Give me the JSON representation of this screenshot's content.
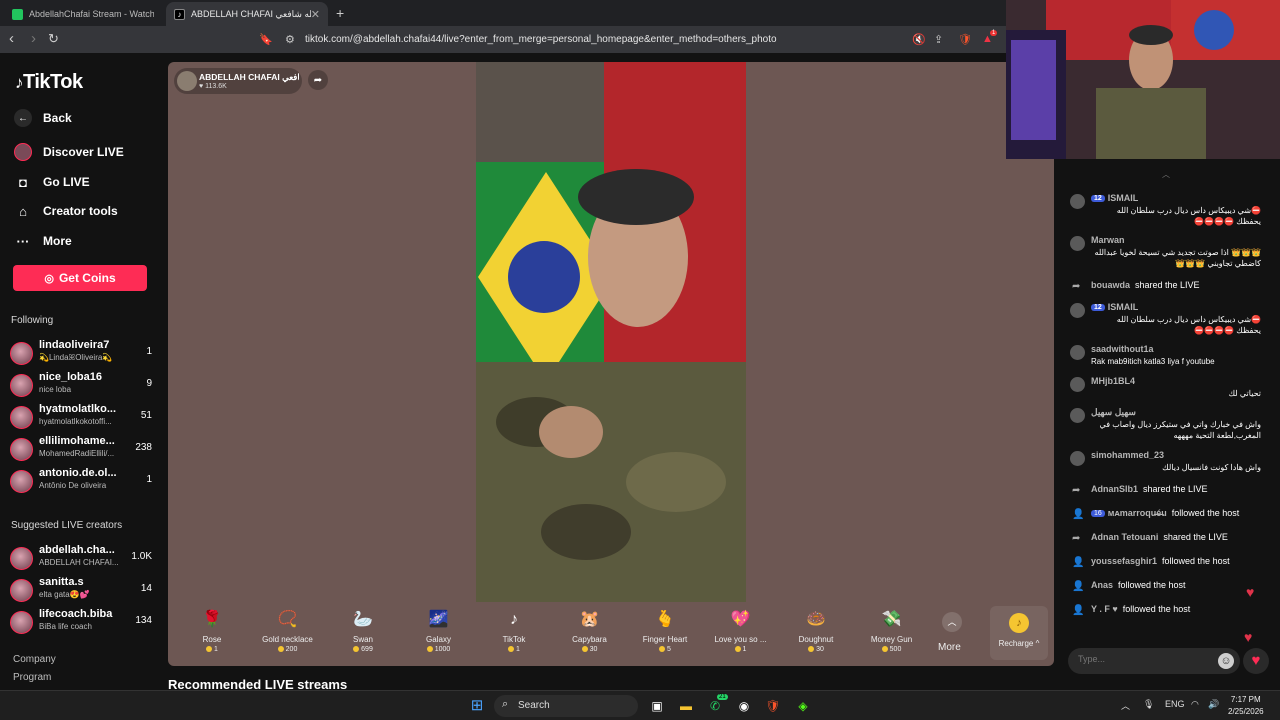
{
  "browser": {
    "tabs": [
      {
        "title": "AbdellahChafai Stream - Watch Live",
        "active": false,
        "favicon_color": "#22c55e"
      },
      {
        "title": "ABDELLAH CHAFAI عبدالله شافعي",
        "active": true,
        "favicon_color": "#000000"
      }
    ],
    "new_tab_label": "+",
    "url": "tiktok.com/@abdellah.chafai44/live?enter_from_merge=personal_homepage&enter_method=others_photo",
    "extension_badge": "1"
  },
  "sidebar": {
    "logo": "TikTok",
    "nav": [
      {
        "label": "Back",
        "icon": "arrow-left-icon"
      },
      {
        "label": "Discover LIVE",
        "icon": "live-avatar-icon"
      },
      {
        "label": "Go LIVE",
        "icon": "camera-icon"
      },
      {
        "label": "Creator tools",
        "icon": "home-icon"
      },
      {
        "label": "More",
        "icon": "ellipsis-icon"
      }
    ],
    "get_coins_label": "Get Coins",
    "following_title": "Following",
    "following": [
      {
        "name": "lindaoliveira7",
        "sub": "💫LindaꕤOliveira💫",
        "count": "1"
      },
      {
        "name": "nice_loba16",
        "sub": "nice loba",
        "count": "9"
      },
      {
        "name": "hyatmolatlko...",
        "sub": "hyatmolatlkokotoffi...",
        "count": "51"
      },
      {
        "name": "ellilimohame...",
        "sub": "MohamedRadiEllili/...",
        "count": "238"
      },
      {
        "name": "antonio.de.ol...",
        "sub": "Antônio De oliveira",
        "count": "1"
      }
    ],
    "suggested_title": "Suggested LIVE creators",
    "suggested": [
      {
        "name": "abdellah.cha...",
        "sub": "ABDELLAH CHAFAI...",
        "count": "1.0K"
      },
      {
        "name": "sanitta.s",
        "sub": "elta gata😍💕",
        "count": "14"
      },
      {
        "name": "lifecoach.biba",
        "sub": "BiBa life coach",
        "count": "134"
      }
    ],
    "footer": [
      "Company",
      "Program"
    ]
  },
  "live": {
    "host_name": "ABDELLAH CHAFAI عبدالله شافعي",
    "likes": "♥ 113.6K",
    "share_icon": "share-arrow-icon",
    "gifts": [
      {
        "name": "Rose",
        "price": "1",
        "icon": "rose-icon",
        "glyph": "🌹"
      },
      {
        "name": "Gold necklace",
        "price": "200",
        "icon": "necklace-icon",
        "glyph": "📿"
      },
      {
        "name": "Swan",
        "price": "699",
        "icon": "swan-icon",
        "glyph": "🦢"
      },
      {
        "name": "Galaxy",
        "price": "1000",
        "icon": "galaxy-icon",
        "glyph": "🌌"
      },
      {
        "name": "TikTok",
        "price": "1",
        "icon": "tiktok-icon",
        "glyph": "♪"
      },
      {
        "name": "Capybara",
        "price": "30",
        "icon": "capybara-icon",
        "glyph": "🐹"
      },
      {
        "name": "Finger Heart",
        "price": "5",
        "icon": "finger-heart-icon",
        "glyph": "🫰"
      },
      {
        "name": "Love you so ...",
        "price": "1",
        "icon": "love-icon",
        "glyph": "💖"
      },
      {
        "name": "Doughnut",
        "price": "30",
        "icon": "doughnut-icon",
        "glyph": "🍩"
      },
      {
        "name": "Money Gun",
        "price": "500",
        "icon": "money-gun-icon",
        "glyph": "💸"
      }
    ],
    "more_label": "More",
    "recharge_label": "Recharge ^"
  },
  "recommended_title": "Recommended LIVE streams",
  "chat": {
    "messages": [
      {
        "user": "ISMAIL",
        "badge": "12",
        "text": "⛔شي ديبيكاس داس ديال درب سلطان الله يحفظك ⛔⛔⛔⛔",
        "type": "comment"
      },
      {
        "user": "Marwan",
        "badge": "",
        "text": "👑👑👑 اذا صوتت تجديد شي تسيحة لخويا عبدالله كاضطي تجاوبني 👑👑👑",
        "type": "comment"
      },
      {
        "user": "bouawda",
        "text": "shared the LIVE",
        "type": "share"
      },
      {
        "user": "ISMAIL",
        "badge": "12",
        "text": "⛔شي ديبيكاس داس ديال درب سلطان الله يحفظك ⛔⛔⛔⛔",
        "type": "comment"
      },
      {
        "user": "saadwithout1a",
        "badge": "",
        "text": "Rak mab9itich katla3 liya f youtube",
        "type": "comment"
      },
      {
        "user": "MHjb1BL4",
        "badge": "",
        "text": "تحياتي لك",
        "type": "comment"
      },
      {
        "user": "سهيل سهيل",
        "badge": "",
        "text": "واش في خبارك واتي في ستيكرز ديال واصاب في المغرب,لطعة التحية مهههه",
        "type": "comment"
      },
      {
        "user": "simohammed_23",
        "badge": "",
        "text": "واش هادا كونت فانسيال ديالك",
        "type": "comment"
      },
      {
        "user": "AdnanSlb1",
        "text": "shared the LIVE",
        "type": "share"
      },
      {
        "user": "ᴍᴀmarroqu̶é̶u",
        "badge": "16",
        "text": "followed the host",
        "type": "follow"
      },
      {
        "user": "Adnan Tetouani",
        "text": "shared the LIVE",
        "type": "share"
      },
      {
        "user": "youssefasghir1",
        "text": "followed the host",
        "type": "follow"
      },
      {
        "user": "Anas",
        "text": "followed the host",
        "type": "follow"
      },
      {
        "user": "Y . F ♥",
        "text": "followed the host",
        "type": "follow"
      }
    ],
    "input_placeholder": "Type..."
  },
  "taskbar": {
    "search_label": "Search",
    "whatsapp_badge": "21",
    "lang": "ENG",
    "time": "7:17 PM",
    "date": "2/25/2026"
  },
  "colors": {
    "accent": "#fe2c55",
    "stage_bg": "#6d5753",
    "coin": "#f5c531"
  }
}
